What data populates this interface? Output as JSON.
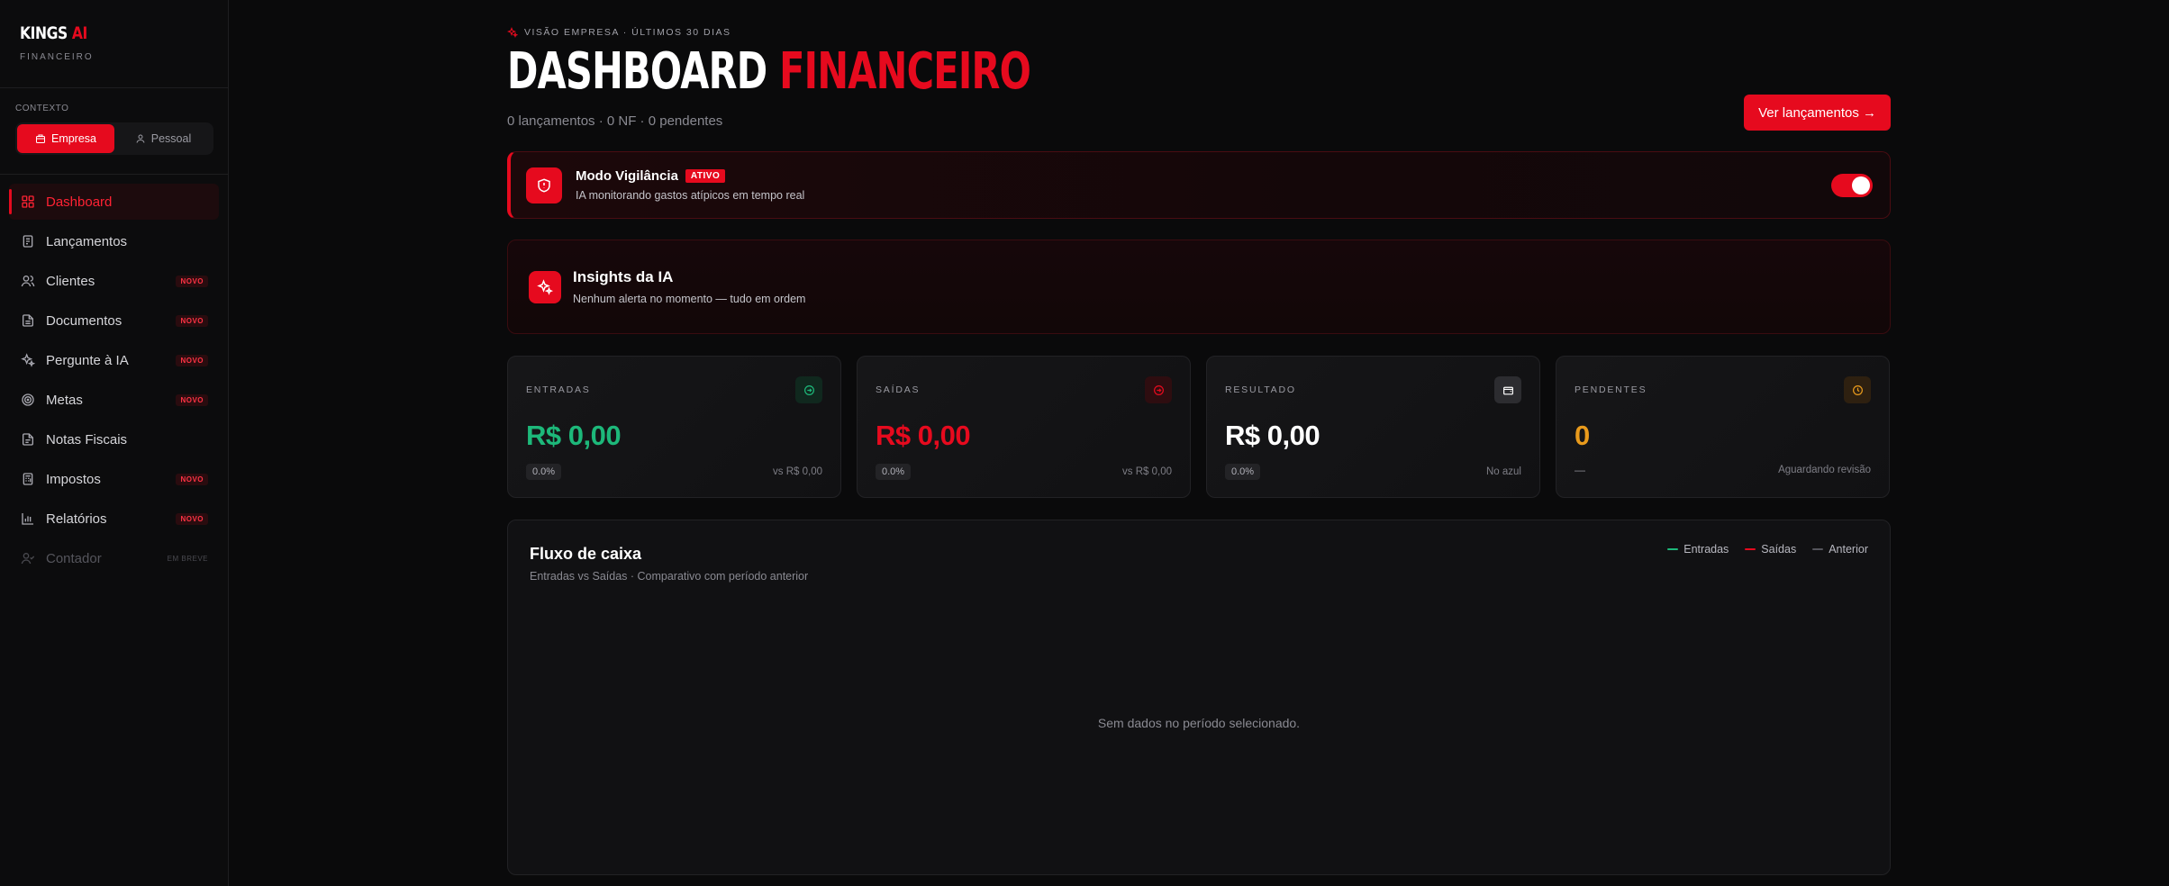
{
  "brand": {
    "name_main": "KINGS",
    "name_accent": "AI",
    "subtitle": "FINANCEIRO"
  },
  "context": {
    "label": "CONTEXTO",
    "options": [
      {
        "label": "Empresa",
        "icon": "building-icon",
        "active": true
      },
      {
        "label": "Pessoal",
        "icon": "user-icon",
        "active": false
      }
    ]
  },
  "sidebar": {
    "items": [
      {
        "label": "Dashboard",
        "icon": "grid-icon",
        "badge": "",
        "active": true
      },
      {
        "label": "Lançamentos",
        "icon": "receipt-icon",
        "badge": ""
      },
      {
        "label": "Clientes",
        "icon": "users-icon",
        "badge": "NOVO"
      },
      {
        "label": "Documentos",
        "icon": "document-icon",
        "badge": "NOVO"
      },
      {
        "label": "Pergunte à IA",
        "icon": "sparkles-icon",
        "badge": "NOVO"
      },
      {
        "label": "Metas",
        "icon": "target-icon",
        "badge": "NOVO"
      },
      {
        "label": "Notas Fiscais",
        "icon": "file-text-icon",
        "badge": ""
      },
      {
        "label": "Impostos",
        "icon": "calculator-icon",
        "badge": "NOVO"
      },
      {
        "label": "Relatórios",
        "icon": "bar-chart-icon",
        "badge": "NOVO"
      },
      {
        "label": "Contador",
        "icon": "user-check-icon",
        "badge": "EM BREVE",
        "disabled": true
      }
    ]
  },
  "header": {
    "eyebrow": "VISÃO EMPRESA · ÚLTIMOS 30 DIAS",
    "title_white": "DASHBOARD",
    "title_red": "FINANCEIRO",
    "subtitle": "0 lançamentos · 0 NF · 0 pendentes",
    "primary_button": "Ver lançamentos →"
  },
  "vigilance": {
    "title": "Modo Vigilância",
    "status": "ATIVO",
    "description": "IA monitorando gastos atípicos em tempo real",
    "enabled": true
  },
  "insights": {
    "title": "Insights da IA",
    "description": "Nenhum alerta no momento — tudo em ordem"
  },
  "kpis": {
    "entradas": {
      "label": "ENTRADAS",
      "value": "R$ 0,00",
      "change": "0.0%",
      "note": "vs R$ 0,00",
      "icon": "arrow-circle-icon"
    },
    "saidas": {
      "label": "SAÍDAS",
      "value": "R$ 0,00",
      "change": "0.0%",
      "note": "vs R$ 0,00",
      "icon": "arrow-circle-icon"
    },
    "resultado": {
      "label": "RESULTADO",
      "value": "R$ 0,00",
      "change": "0.0%",
      "note": "No azul",
      "icon": "wallet-icon"
    },
    "pendentes": {
      "label": "PENDENTES",
      "value": "0",
      "change": "—",
      "note": "Aguardando revisão",
      "icon": "clock-icon"
    }
  },
  "cashflow": {
    "title": "Fluxo de caixa",
    "subtitle": "Entradas vs Saídas · Comparativo com período anterior",
    "legend": [
      "Entradas",
      "Saídas",
      "Anterior"
    ],
    "empty_message": "Sem dados no período selecionado."
  },
  "colors": {
    "accent": "#e60a1e",
    "positive": "#1db87a",
    "negative": "#e60a1e",
    "warning": "#e89a1c",
    "neutral": "#ffffff"
  }
}
